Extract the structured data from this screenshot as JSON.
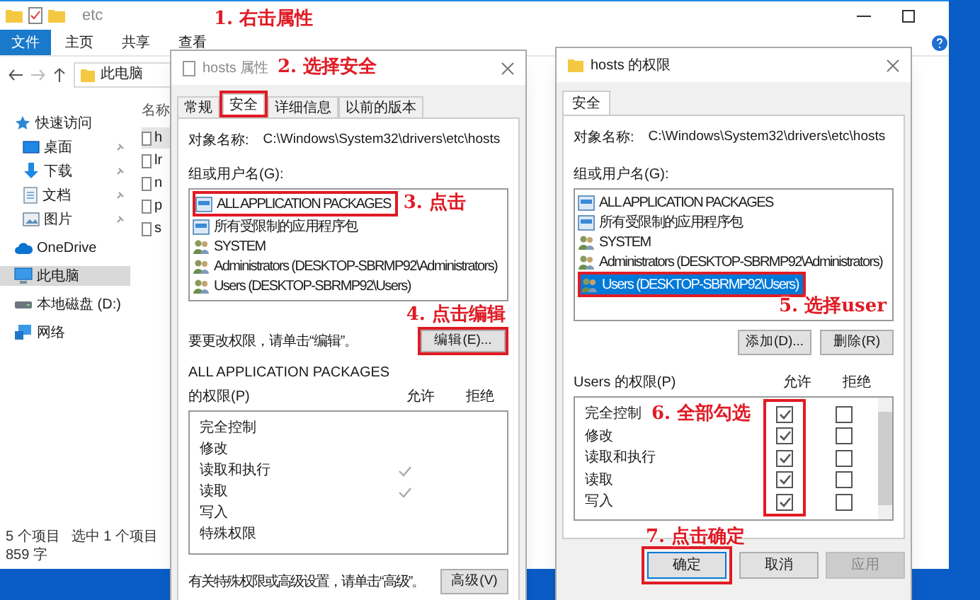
{
  "explorer": {
    "title": "etc",
    "ribbon_tabs": [
      {
        "label": "文件",
        "selected": true
      },
      {
        "label": "主页",
        "selected": false
      },
      {
        "label": "共享",
        "selected": false
      },
      {
        "label": "查看",
        "selected": false
      }
    ],
    "address": "此电脑",
    "sidebar": [
      {
        "label": "快速访问",
        "kind": "star",
        "pinned": false,
        "selected": false
      },
      {
        "label": "桌面",
        "kind": "desktop",
        "pinned": true,
        "selected": false
      },
      {
        "label": "下载",
        "kind": "download",
        "pinned": true,
        "selected": false
      },
      {
        "label": "文档",
        "kind": "document",
        "pinned": true,
        "selected": false
      },
      {
        "label": "图片",
        "kind": "picture",
        "pinned": true,
        "selected": false
      },
      {
        "label": "OneDrive",
        "kind": "cloud",
        "pinned": false,
        "selected": false
      },
      {
        "label": "此电脑",
        "kind": "pc",
        "pinned": false,
        "selected": true
      },
      {
        "label": "本地磁盘 (D:)",
        "kind": "drive",
        "pinned": false,
        "selected": false
      },
      {
        "label": "网络",
        "kind": "network",
        "pinned": false,
        "selected": false
      }
    ],
    "column_header": "名称",
    "files": [
      {
        "name": "h",
        "selected": true
      },
      {
        "name": "lr",
        "selected": false
      },
      {
        "name": "n",
        "selected": false
      },
      {
        "name": "p",
        "selected": false
      },
      {
        "name": "s",
        "selected": false
      }
    ],
    "status": [
      "5 个项目",
      "选中 1 个项目",
      "859 字"
    ]
  },
  "properties": {
    "title": "hosts 属性",
    "tabs": [
      {
        "label": "常规",
        "selected": false
      },
      {
        "label": "安全",
        "selected": true
      },
      {
        "label": "详细信息",
        "selected": false
      },
      {
        "label": "以前的版本",
        "selected": false
      }
    ],
    "object_label": "对象名称:",
    "object_path": "C:\\Windows\\System32\\drivers\\etc\\hosts",
    "group_label": "组或用户名(G):",
    "users": [
      {
        "name": "ALL APPLICATION PACKAGES",
        "kind": "package"
      },
      {
        "name": "所有受限制的应用程序包",
        "kind": "package"
      },
      {
        "name": "SYSTEM",
        "kind": "user"
      },
      {
        "name": "Administrators (DESKTOP-SBRMP92\\Administrators)",
        "kind": "user"
      },
      {
        "name": "Users (DESKTOP-SBRMP92\\Users)",
        "kind": "user"
      }
    ],
    "edit_hint": "要更改权限，请单击“编辑”。",
    "edit_button": "编辑(E)...",
    "perm_subject": "ALL APPLICATION PACKAGES",
    "perm_label": "的权限(P)",
    "allow_header": "允许",
    "deny_header": "拒绝",
    "permissions": [
      {
        "name": "完全控制",
        "allow": false
      },
      {
        "name": "修改",
        "allow": false
      },
      {
        "name": "读取和执行",
        "allow": true
      },
      {
        "name": "读取",
        "allow": true
      },
      {
        "name": "写入",
        "allow": false
      },
      {
        "name": "特殊权限",
        "allow": false
      }
    ],
    "advanced_hint": "有关特殊权限或高级设置，请单击“高级”。",
    "advanced_button": "高级(V)"
  },
  "permissions_dialog": {
    "title": "hosts 的权限",
    "tab": "安全",
    "object_label": "对象名称:",
    "object_path": "C:\\Windows\\System32\\drivers\\etc\\hosts",
    "group_label": "组或用户名(G):",
    "users": [
      {
        "name": "ALL APPLICATION PACKAGES",
        "kind": "package",
        "selected": false
      },
      {
        "name": "所有受限制的应用程序包",
        "kind": "package",
        "selected": false
      },
      {
        "name": "SYSTEM",
        "kind": "user",
        "selected": false
      },
      {
        "name": "Administrators (DESKTOP-SBRMP92\\Administrators)",
        "kind": "user",
        "selected": false
      },
      {
        "name": "Users (DESKTOP-SBRMP92\\Users)",
        "kind": "user",
        "selected": true
      }
    ],
    "add_button": "添加(D)...",
    "remove_button": "删除(R)",
    "perm_label": "Users 的权限(P)",
    "allow_header": "允许",
    "deny_header": "拒绝",
    "permissions": [
      {
        "name": "完全控制",
        "allow": true,
        "deny": false
      },
      {
        "name": "修改",
        "allow": true,
        "deny": false
      },
      {
        "name": "读取和执行",
        "allow": true,
        "deny": false
      },
      {
        "name": "读取",
        "allow": true,
        "deny": false
      },
      {
        "name": "写入",
        "allow": true,
        "deny": false
      }
    ],
    "buttons": [
      {
        "label": "确定",
        "disabled": false
      },
      {
        "label": "取消",
        "disabled": false
      },
      {
        "label": "应用",
        "disabled": true
      }
    ]
  },
  "annotations": [
    "1. 右击属性",
    "2. 选择安全",
    "3. 点击",
    "4. 点击编辑",
    "5. 选择user",
    "6. 全部勾选",
    "7. 点击确定"
  ]
}
